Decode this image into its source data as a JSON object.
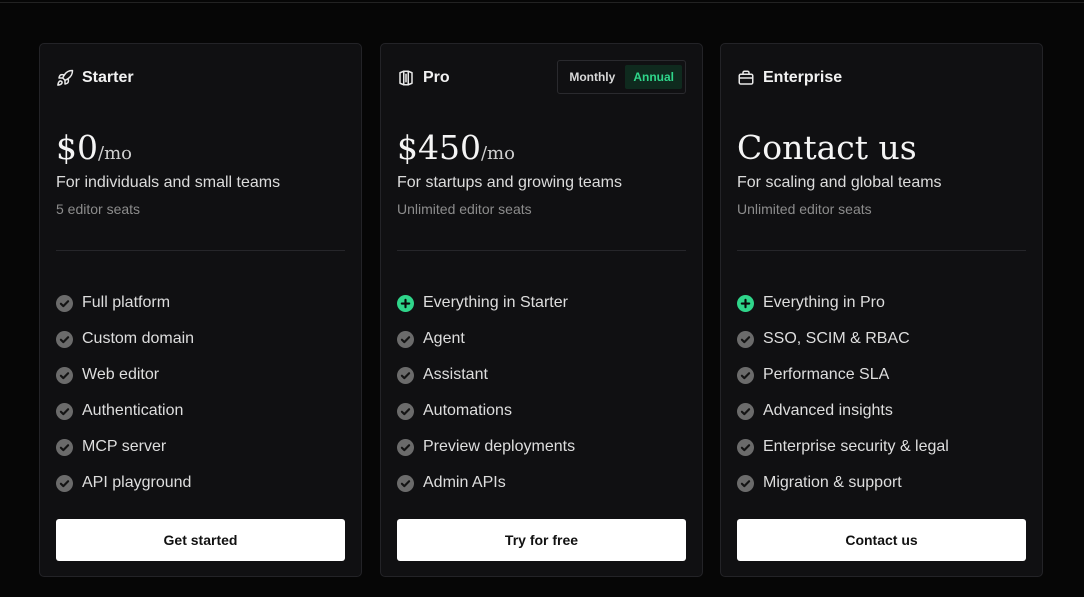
{
  "plans": [
    {
      "name": "Starter",
      "icon": "rocket-icon",
      "price": "$0",
      "price_unit": "/mo",
      "description": "For individuals and small teams",
      "seats": "5 editor seats",
      "features": [
        {
          "label": "Full platform",
          "highlight": false
        },
        {
          "label": "Custom domain",
          "highlight": false
        },
        {
          "label": "Web editor",
          "highlight": false
        },
        {
          "label": "Authentication",
          "highlight": false
        },
        {
          "label": "MCP server",
          "highlight": false
        },
        {
          "label": "API playground",
          "highlight": false
        }
      ],
      "cta": "Get started"
    },
    {
      "name": "Pro",
      "icon": "book-icon",
      "price": "$450",
      "price_unit": "/mo",
      "description": "For startups and growing teams",
      "seats": "Unlimited editor seats",
      "billing_toggle": {
        "options": [
          "Monthly",
          "Annual"
        ],
        "selected": "Annual"
      },
      "features": [
        {
          "label": "Everything in Starter",
          "highlight": true
        },
        {
          "label": "Agent",
          "highlight": false
        },
        {
          "label": "Assistant",
          "highlight": false
        },
        {
          "label": "Automations",
          "highlight": false
        },
        {
          "label": "Preview deployments",
          "highlight": false
        },
        {
          "label": "Admin APIs",
          "highlight": false
        }
      ],
      "cta": "Try for free"
    },
    {
      "name": "Enterprise",
      "icon": "briefcase-icon",
      "price": "Contact us",
      "price_unit": "",
      "description": "For scaling and global teams",
      "seats": "Unlimited editor seats",
      "features": [
        {
          "label": "Everything in Pro",
          "highlight": true
        },
        {
          "label": "SSO, SCIM & RBAC",
          "highlight": false
        },
        {
          "label": "Performance SLA",
          "highlight": false
        },
        {
          "label": "Advanced insights",
          "highlight": false
        },
        {
          "label": "Enterprise security & legal",
          "highlight": false
        },
        {
          "label": "Migration & support",
          "highlight": false
        }
      ],
      "cta": "Contact us"
    }
  ],
  "colors": {
    "accent": "#2fd58a",
    "check": "#6b6b6b",
    "card_bg": "#101012",
    "page_bg": "#060606"
  }
}
